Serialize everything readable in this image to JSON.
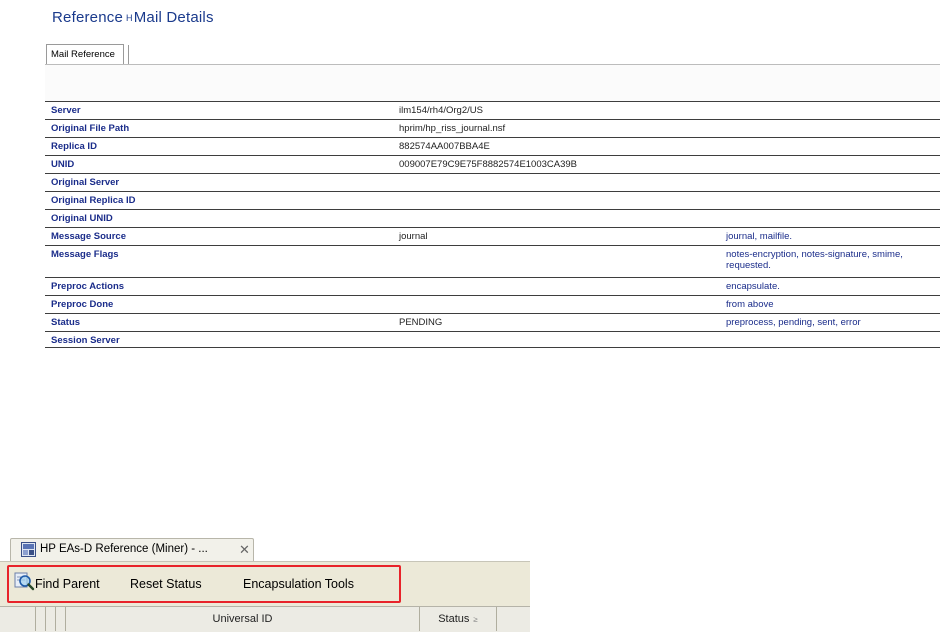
{
  "header": {
    "title_left": "Reference",
    "title_sep": "H",
    "title_right": "Mail Details"
  },
  "tabs": {
    "mail_reference": "Mail Reference"
  },
  "fields": [
    {
      "label": "Server",
      "value": "ilm154/rh4/Org2/US",
      "options": ""
    },
    {
      "label": "Original File Path",
      "value": "hprim/hp_riss_journal.nsf",
      "options": ""
    },
    {
      "label": "Replica ID",
      "value": "882574AA007BBA4E",
      "options": ""
    },
    {
      "label": "UNID",
      "value": "009007E79C9E75F8882574E1003CA39B",
      "options": ""
    },
    {
      "label": "Original Server",
      "value": "",
      "options": ""
    },
    {
      "label": "Original Replica ID",
      "value": "",
      "options": ""
    },
    {
      "label": "Original UNID",
      "value": "",
      "options": ""
    },
    {
      "label": "Message Source",
      "value": "journal",
      "options": "journal, mailfile."
    },
    {
      "label": "Message Flags",
      "value": "",
      "options": "notes-encryption, notes-signature, smime, requested."
    },
    {
      "label": "Preproc Actions",
      "value": "",
      "options": "encapsulate."
    },
    {
      "label": "Preproc Done",
      "value": "",
      "options": "from above"
    },
    {
      "label": "Status",
      "value": "PENDING",
      "options": "preprocess, pending, sent, error"
    },
    {
      "label": "Session Server",
      "value": "",
      "options": ""
    }
  ],
  "window": {
    "tab_title": "HP EAs-D Reference (Miner) - ...",
    "close_glyph": "✕",
    "icon": "app-window-icon"
  },
  "toolbar": {
    "find_parent": "Find Parent",
    "reset_status": "Reset Status",
    "encapsulation_tools": "Encapsulation Tools",
    "find_icon": "magnifier-icon",
    "highlight_color": "#e8232a"
  },
  "columns": {
    "universal_id": "Universal ID",
    "status": "Status",
    "sort_glyph": "≥"
  }
}
